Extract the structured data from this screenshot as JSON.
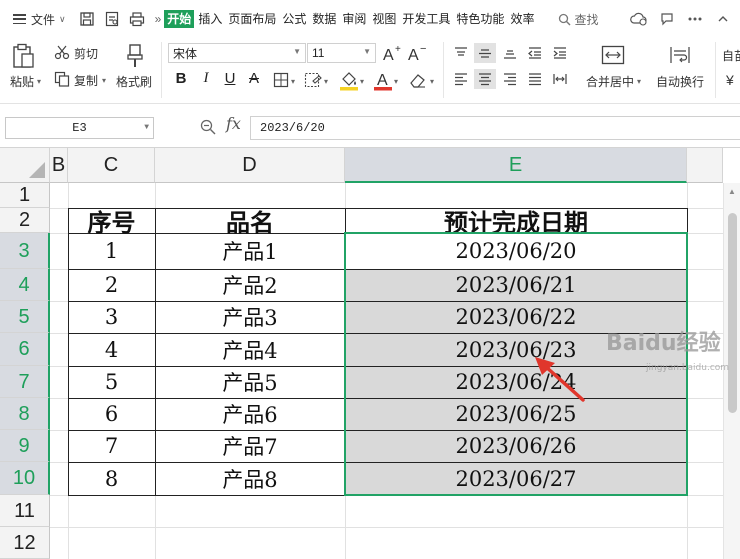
{
  "menubar": {
    "file_label": "文件",
    "tabs": [
      "开始",
      "插入",
      "页面布局",
      "公式",
      "数据",
      "审阅",
      "视图",
      "开发工具",
      "特色功能",
      "效率"
    ],
    "active_tab": "开始",
    "search_label": "查找"
  },
  "ribbon": {
    "paste_label": "粘贴",
    "cut_label": "剪切",
    "copy_label": "复制",
    "format_painter_label": "格式刷",
    "font_name": "宋体",
    "font_size": "11",
    "bold": "B",
    "italic": "I",
    "underline": "U",
    "strike": "A",
    "font_color_glyph": "A",
    "merge_center_label": "合并居中",
    "wrap_text_label": "自动换行",
    "auto_label": "自苗",
    "currency_glyph": "¥"
  },
  "formula_bar": {
    "cell_ref": "E3",
    "fx_label": "fx",
    "value": "2023/6/20"
  },
  "sheet": {
    "columns": [
      "B",
      "C",
      "D",
      "E"
    ],
    "selected_column": "E",
    "rows": [
      "1",
      "2",
      "3",
      "4",
      "5",
      "6",
      "7",
      "8",
      "9",
      "10",
      "11",
      "12"
    ],
    "selected_rows": [
      "3",
      "4",
      "5",
      "6",
      "7",
      "8",
      "9",
      "10"
    ],
    "table_header": [
      "序号",
      "品名",
      "预计完成日期"
    ],
    "table_rows": [
      [
        "1",
        "产品1",
        "2023/06/20"
      ],
      [
        "2",
        "产品2",
        "2023/06/21"
      ],
      [
        "3",
        "产品3",
        "2023/06/22"
      ],
      [
        "4",
        "产品4",
        "2023/06/23"
      ],
      [
        "5",
        "产品5",
        "2023/06/24"
      ],
      [
        "6",
        "产品6",
        "2023/06/25"
      ],
      [
        "7",
        "产品7",
        "2023/06/26"
      ],
      [
        "8",
        "产品8",
        "2023/06/27"
      ]
    ]
  },
  "colors": {
    "accent_green": "#21a366",
    "active_tab_bg": "#1e9f5a",
    "selection_fill": "#d9d9d9",
    "arrow_red": "#e0362c"
  },
  "watermark": {
    "brand": "Baidu经验",
    "url": "jingyan.baidu.com"
  }
}
